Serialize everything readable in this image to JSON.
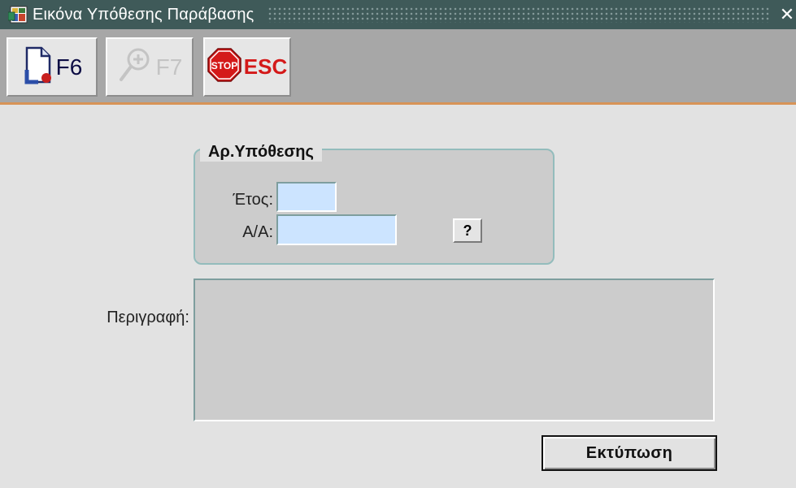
{
  "window": {
    "title": "Εικόνα Υπόθεσης Παράβασης",
    "close_symbol": "✕"
  },
  "toolbar": {
    "buttons": [
      {
        "label": "F6",
        "icon": "new-document-icon",
        "enabled": true
      },
      {
        "label": "F7",
        "icon": "zoom-in-icon",
        "enabled": false
      },
      {
        "label": "ESC",
        "icon": "stop-sign-icon",
        "icon_text": "STOP",
        "enabled": true
      }
    ]
  },
  "case_group": {
    "title": "Αρ.Υπόθεσης",
    "year_label": "Έτος:",
    "year_value": "",
    "serial_label": "Α/Α:",
    "serial_value": "",
    "lookup_label": "?"
  },
  "description": {
    "label": "Περιγραφή:",
    "value": ""
  },
  "print_button": {
    "label": "Εκτύπωση"
  },
  "colors": {
    "titlebar": "#3f5a59",
    "toolbar": "#a7a7a7",
    "toolbar_accent": "#d79357",
    "background": "#e2e2e2",
    "field": "#cce4ff",
    "panel": "#cccccc",
    "stop": "#d41919"
  }
}
